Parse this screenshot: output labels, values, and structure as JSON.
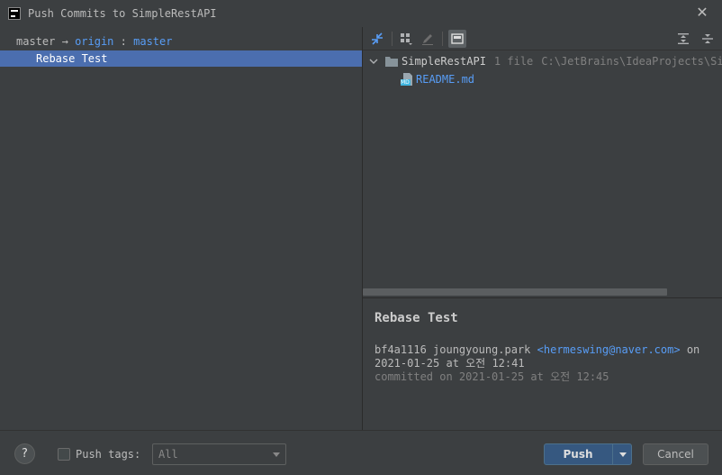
{
  "window": {
    "title": "Push Commits to SimpleRestAPI"
  },
  "branch": {
    "local": "master",
    "arrow": "→",
    "remote": "origin",
    "sep": ":",
    "remote_branch": "master"
  },
  "commits": [
    {
      "subject": "Rebase Test"
    }
  ],
  "tree": {
    "repo_name": "SimpleRestAPI",
    "repo_count": "1 file",
    "repo_path": "C:\\JetBrains\\IdeaProjects\\Simp",
    "file_name": "README.md",
    "file_icon_label": "MD"
  },
  "details": {
    "subject": "Rebase Test",
    "hash": "bf4a1116",
    "author": "joungyoung.park",
    "email": "<hermeswing@naver.com>",
    "on": "on",
    "authored_at": "2021-01-25 at 오전 12:41",
    "committed": "committed on 2021-01-25 at 오전 12:45"
  },
  "footer": {
    "help": "?",
    "push_tags_label": "Push tags:",
    "push_tags_value": "All",
    "push_label": "Push",
    "cancel_label": "Cancel"
  },
  "colors": {
    "accent": "#589df6",
    "selection": "#4b6eaf",
    "primary_button": "#365880",
    "background": "#3c3f41"
  }
}
